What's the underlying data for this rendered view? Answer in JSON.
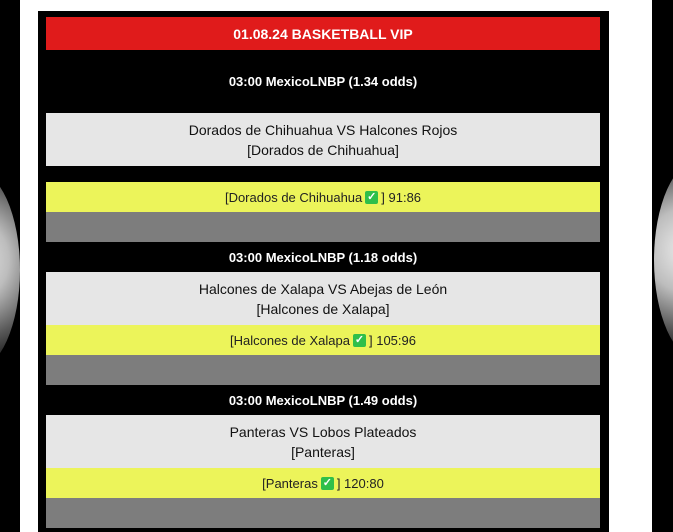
{
  "header": {
    "title": "01.08.24 BASKETBALL VIP"
  },
  "matches": [
    {
      "info": "03:00 MexicoLNBP (1.34 odds)",
      "teams": "Dorados de Chihuahua VS Halcones Rojos",
      "pick": "[Dorados de Chihuahua]",
      "result_team": "[Dorados de Chihuahua",
      "result_score": "] 91:86"
    },
    {
      "info": "03:00 MexicoLNBP (1.18 odds)",
      "teams": "Halcones de Xalapa VS Abejas de León",
      "pick": "[Halcones de Xalapa]",
      "result_team": "[Halcones de Xalapa",
      "result_score": "] 105:96"
    },
    {
      "info": "03:00 MexicoLNBP (1.49 odds)",
      "teams": "Panteras VS Lobos Plateados",
      "pick": "[Panteras]",
      "result_team": "[Panteras",
      "result_score": "] 120:80"
    }
  ],
  "icons": {
    "win": "check-icon"
  },
  "colors": {
    "header": "#e01b1b",
    "result": "#ecf45a",
    "check": "#2fbf4a"
  }
}
